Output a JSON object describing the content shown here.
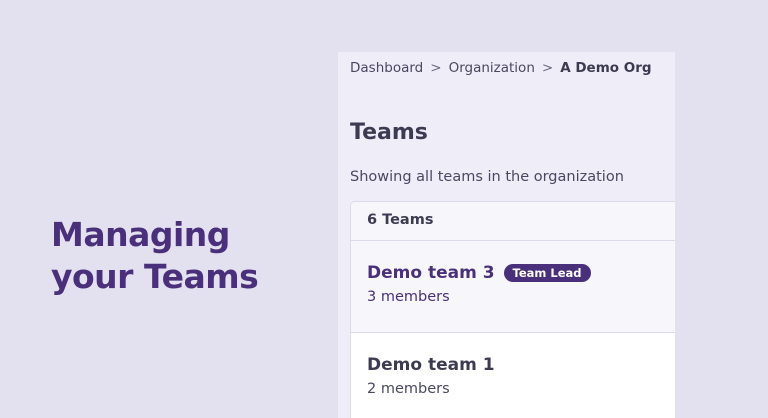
{
  "hero": {
    "line1": "Managing",
    "line2": "your Teams"
  },
  "breadcrumb": {
    "items": [
      "Dashboard",
      "Organization"
    ],
    "current": "A Demo Org",
    "separator": ">"
  },
  "page": {
    "title": "Teams",
    "subtitle": "Showing all teams in the organization"
  },
  "teams": {
    "count_label": "6 Teams",
    "items": [
      {
        "name": "Demo team 3",
        "badge": "Team Lead",
        "members": "3 members"
      },
      {
        "name": "Demo team 1",
        "members": "2 members"
      }
    ]
  },
  "colors": {
    "accent": "#4a2f7b",
    "background": "#e3e0ef"
  }
}
